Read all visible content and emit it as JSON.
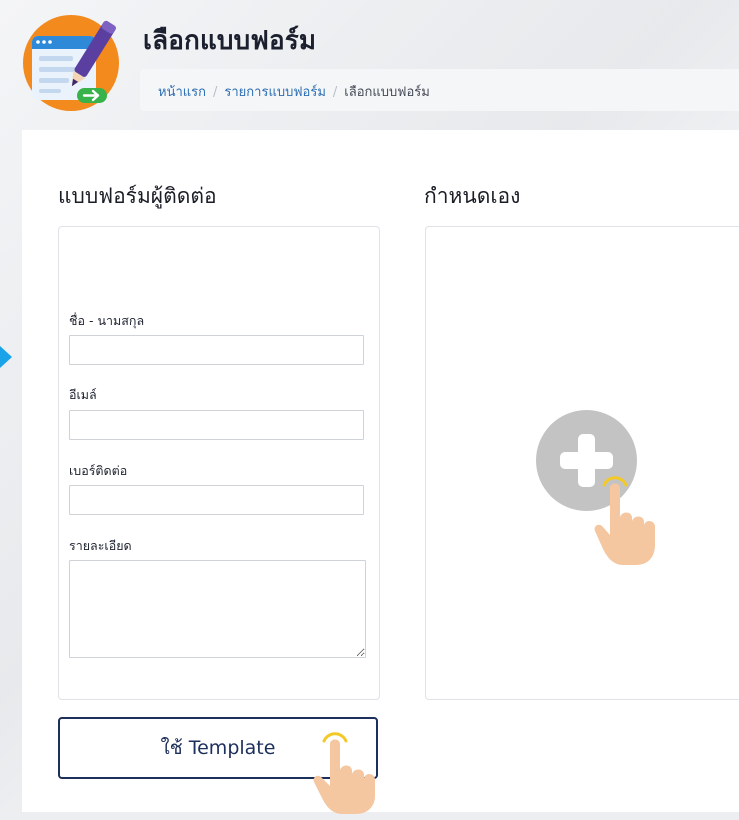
{
  "header": {
    "title": "เลือกแบบฟอร์ม",
    "logo_icon": "form-document-pen-icon"
  },
  "breadcrumb": {
    "items": [
      {
        "label": "หน้าแรก",
        "link": true
      },
      {
        "label": "รายการแบบฟอร์ม",
        "link": true
      },
      {
        "label": "เลือกแบบฟอร์ม",
        "link": false
      }
    ],
    "separator": "/"
  },
  "template_section": {
    "heading": "แบบฟอร์มผู้ติดต่อ",
    "fields": [
      {
        "label": "ชื่อ - นามสกุล",
        "type": "text",
        "value": "",
        "placeholder": ""
      },
      {
        "label": "อีเมล์",
        "type": "text",
        "value": "",
        "placeholder": ""
      },
      {
        "label": "เบอร์ติดต่อ",
        "type": "text",
        "value": "",
        "placeholder": ""
      },
      {
        "label": "รายละเอียด",
        "type": "textarea",
        "value": "",
        "placeholder": ""
      }
    ],
    "button_label": "ใช้ Template"
  },
  "custom_section": {
    "heading": "กำหนดเอง",
    "add_icon": "plus-circle-icon"
  },
  "colors": {
    "link": "#2f6fb2",
    "button_border": "#1d2f5c",
    "plus_circle": "#c3c3c3",
    "hand_skin": "#f4c7a1",
    "tap_ring": "#f3c928",
    "side_arrow": "#1aa3e8"
  }
}
